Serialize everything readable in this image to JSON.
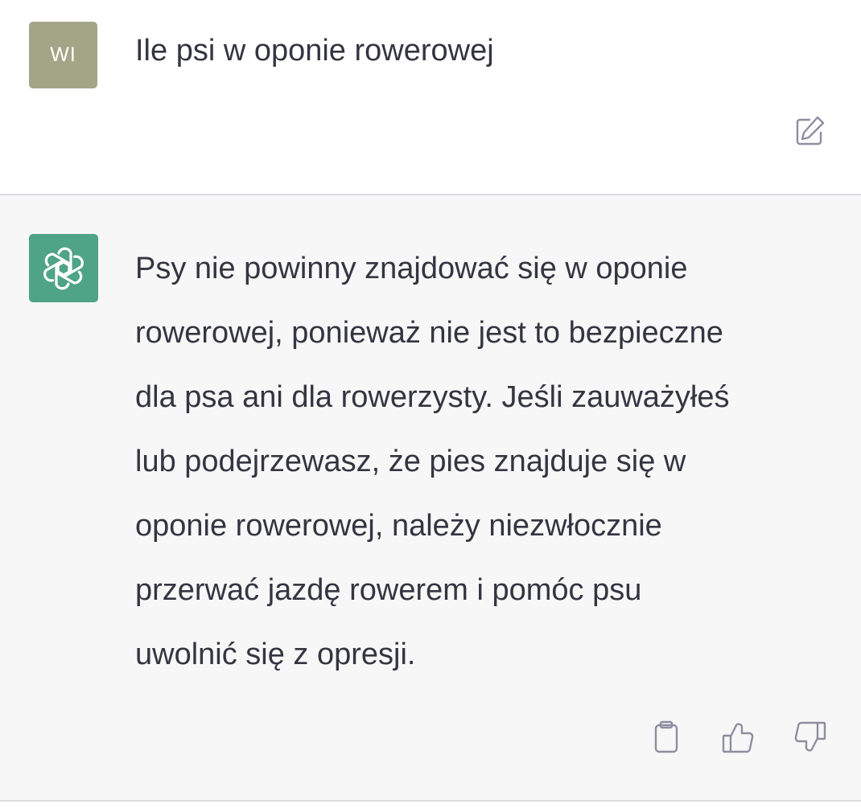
{
  "user": {
    "avatar_initials": "WI",
    "avatar_color": "#a4a587",
    "message": "Ile psi w oponie rowerowej",
    "edit_icon": "edit-icon"
  },
  "assistant": {
    "avatar_icon": "openai-logo-icon",
    "avatar_color": "#4fa386",
    "message_lines": [
      "Psy nie powinny znajdować się w oponie",
      "rowerowej, ponieważ nie jest to bezpieczne",
      "dla psa ani dla rowerzysty. Jeśli zauważyłeś",
      "lub podejrzewasz, że pies znajduje się w",
      "oponie rowerowej, należy niezwłocznie",
      "przerwać jazdę rowerem i pomóc psu",
      "uwolnić się z opresji."
    ],
    "actions": {
      "copy_icon": "clipboard-icon",
      "like_icon": "thumbs-up-icon",
      "dislike_icon": "thumbs-down-icon"
    }
  },
  "colors": {
    "text": "#343541",
    "assistant_background": "#f7f7f8",
    "divider": "#dcdce0",
    "icon": "#8e8ea0"
  }
}
